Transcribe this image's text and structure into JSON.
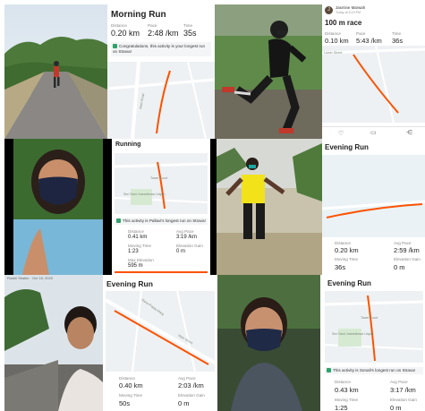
{
  "colors": {
    "route": "#fc5200",
    "achievement": "#2ea36b",
    "map_bg": "#eef1f3"
  },
  "tiles": {
    "morning_run": {
      "title": "Morning Run",
      "distance_label": "Distance",
      "distance": "0.20 km",
      "pace_label": "Pace",
      "pace": "2:48 /km",
      "time_label": "Time",
      "time": "35s",
      "achievement": "Congratulations, this activity is your longest run on Strava!",
      "map_street": "Main Road"
    },
    "race": {
      "user_name": "Jasmine Marwah",
      "date": "Today at 6:19 PM",
      "title": "100 m race",
      "distance_label": "Distance",
      "distance": "0.10 km",
      "pace_label": "Pace",
      "pace": "5:43 /km",
      "time_label": "Time",
      "time": "36s",
      "map_street": "Lower Street"
    },
    "running": {
      "title": "Running",
      "map_place": "Tower Court",
      "map_place_2": "Shri Sant Jnaneshwar Udyan",
      "achievement": "This activity is Pallavi's longest run on Strava!",
      "distance_label": "Distance",
      "distance": "0.41 km",
      "pace_label": "Avg Pace",
      "pace": "3:19 /km",
      "moving_label": "Moving Time",
      "moving": "1:23",
      "elev_label": "Elevation Gain",
      "elev": "0 m",
      "extra_label": "Max Elevation",
      "extra": "595 m"
    },
    "evening_run_1": {
      "title": "Evening Run",
      "distance_label": "Distance",
      "distance": "0.20 km",
      "pace_label": "Avg Pace",
      "pace": "2:59 /km",
      "moving_label": "Moving Time",
      "moving": "36s",
      "elev_label": "Elevation Gain",
      "elev": "0 m"
    },
    "evening_run_2": {
      "title": "Evening Run",
      "photo_caption": "Rushil Shaikh · Oct 18, 2020",
      "map_street": "Rana Pratap Marg",
      "map_street_2": "Main Street",
      "distance_label": "Distance",
      "distance": "0.40 km",
      "pace_label": "Avg Pace",
      "pace": "2:03 /km",
      "moving_label": "Moving Time",
      "moving": "50s",
      "elev_label": "Elevation Gain",
      "elev": "0 m"
    },
    "evening_run_3": {
      "title": "Evening Run",
      "map_place": "Tower Court",
      "map_place_2": "Shri Sant Jnaneshwar Udyan",
      "achievement": "This activity is Sonali's longest run on Strava!",
      "distance_label": "Distance",
      "distance": "0.43 km",
      "pace_label": "Avg Pace",
      "pace": "3:17 /km",
      "moving_label": "Moving Time",
      "moving": "1:25",
      "elev_label": "Elevation Gain",
      "elev": "0 m"
    }
  }
}
